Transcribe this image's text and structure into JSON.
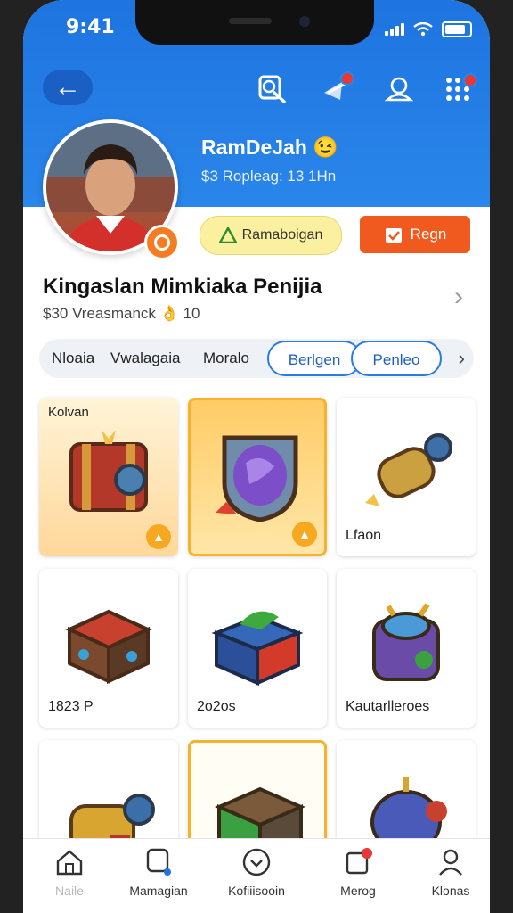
{
  "status": {
    "time": "9:41"
  },
  "header": {
    "back_icon": "arrow-left-icon",
    "icons": [
      "search-icon",
      "notification-icon",
      "profile-badge-icon",
      "grid-menu-icon"
    ]
  },
  "profile": {
    "name": "RamDeJah",
    "emoji": "😉",
    "subtitle": "$3 Ropleag: 13 1Hn"
  },
  "actions": {
    "yellow_label": "Ramaboigan",
    "orange_label": "Regn"
  },
  "section": {
    "title": "Kingaslan Mimkiaka Penijia",
    "subtitle": "$30 Vreasmanck",
    "subtitle_emoji": "👌",
    "subtitle_count": "10"
  },
  "tabs": [
    {
      "label": "Nloaia"
    },
    {
      "label": "Vwalagaia"
    },
    {
      "label": "Moralo"
    },
    {
      "label": "Berlgen"
    },
    {
      "label": "Penleo"
    }
  ],
  "items": [
    {
      "label": "",
      "top_label": "Kolvan",
      "style": "warm",
      "icon": "treasure-chest-icon"
    },
    {
      "label": "",
      "top_label": "",
      "style": "selected",
      "icon": "crystal-shield-icon"
    },
    {
      "label": "Lfaon",
      "top_label": "",
      "style": "plain",
      "icon": "cannon-gadget-icon"
    },
    {
      "label": "1823 P",
      "top_label": "",
      "style": "plain",
      "icon": "red-crate-icon"
    },
    {
      "label": "2o2os",
      "top_label": "",
      "style": "plain",
      "icon": "blue-box-icon"
    },
    {
      "label": "Kautarlleroes",
      "top_label": "",
      "style": "plain",
      "icon": "blue-machine-icon"
    },
    {
      "label": "",
      "top_label": "",
      "style": "plain",
      "icon": "gold-cannon-icon"
    },
    {
      "label": "",
      "top_label": "",
      "style": "selected-plain",
      "icon": "green-box-icon"
    },
    {
      "label": "",
      "top_label": "",
      "style": "plain",
      "icon": "purple-engine-icon"
    }
  ],
  "nav": [
    {
      "label": "Naile",
      "icon": "home-icon",
      "dim": true
    },
    {
      "label": "Mamagian",
      "icon": "search-icon",
      "dim": false
    },
    {
      "label": "Kofiiisooin",
      "icon": "chevron-circle-icon",
      "dim": false
    },
    {
      "label": "Merog",
      "icon": "inbox-icon",
      "dim": false
    },
    {
      "label": "Klonas",
      "icon": "person-icon",
      "dim": false
    }
  ],
  "colors": {
    "header_blue": "#2a86ea",
    "accent_orange": "#f05a1e",
    "accent_yellow": "#fbf0a0",
    "selected_border": "#f4b32a"
  }
}
